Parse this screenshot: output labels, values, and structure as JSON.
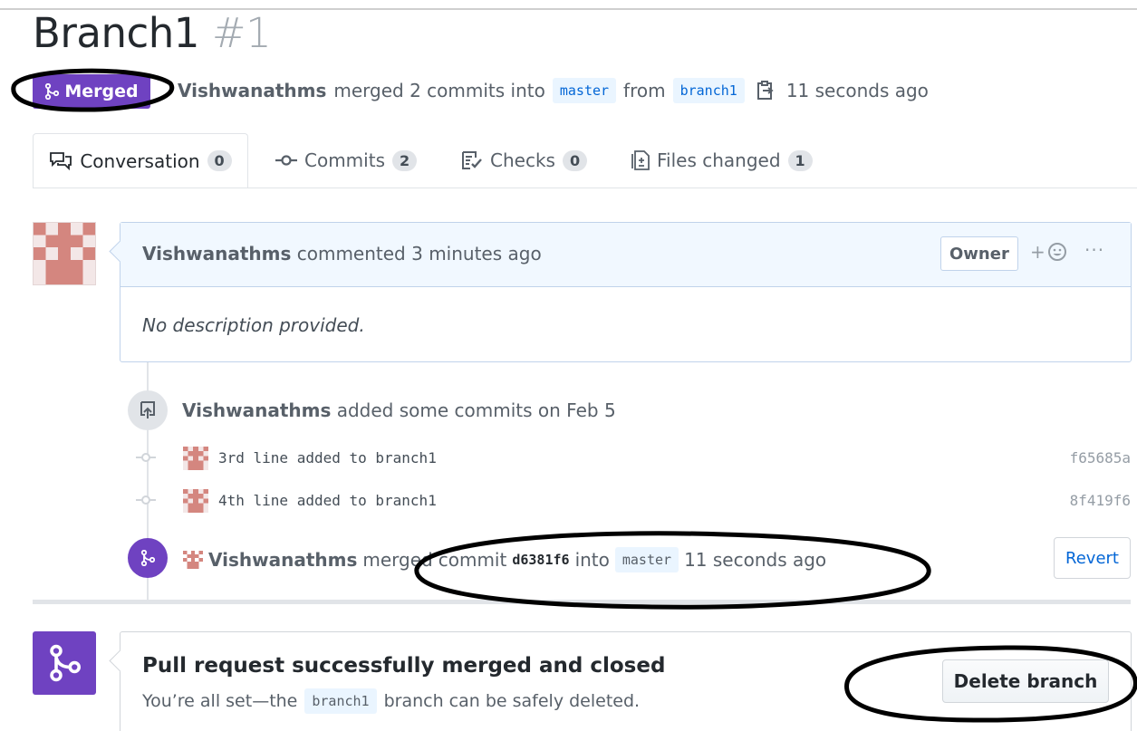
{
  "header": {
    "title": "Branch1",
    "number": "#1",
    "state_badge": "Merged",
    "author": "Vishwanathms",
    "merged_text": "merged 2 commits into",
    "base_branch": "master",
    "from_text": "from",
    "head_branch": "branch1",
    "time": "11 seconds ago"
  },
  "tabs": [
    {
      "label": "Conversation",
      "count": "0",
      "icon": "comment-discussion-icon"
    },
    {
      "label": "Commits",
      "count": "2",
      "icon": "git-commit-icon"
    },
    {
      "label": "Checks",
      "count": "0",
      "icon": "checklist-icon"
    },
    {
      "label": "Files changed",
      "count": "1",
      "icon": "diff-icon"
    }
  ],
  "comment": {
    "author": "Vishwanathms",
    "action": "commented 3 minutes ago",
    "role_label": "Owner",
    "react_plus": "+",
    "more": "···",
    "body": "No description provided."
  },
  "timeline": {
    "event_author": "Vishwanathms",
    "event_text": "added some commits on Feb 5",
    "commits": [
      {
        "message": "3rd line added to branch1",
        "sha": "f65685a"
      },
      {
        "message": "4th line added to branch1",
        "sha": "8f419f6"
      }
    ],
    "merge": {
      "author": "Vishwanathms",
      "text_merged": "merged",
      "text_commit": "commit",
      "sha": "d6381f6",
      "text_into": "into",
      "branch": "master",
      "time": "11 seconds ago",
      "revert_label": "Revert"
    }
  },
  "status": {
    "title": "Pull request successfully merged and closed",
    "sub_before": "You’re all set—the",
    "branch": "branch1",
    "sub_after": "branch can be safely deleted.",
    "delete_label": "Delete branch"
  },
  "colors": {
    "merged_purple": "#6f42c1",
    "link_blue": "#0366d6",
    "annotation": "#000000"
  }
}
